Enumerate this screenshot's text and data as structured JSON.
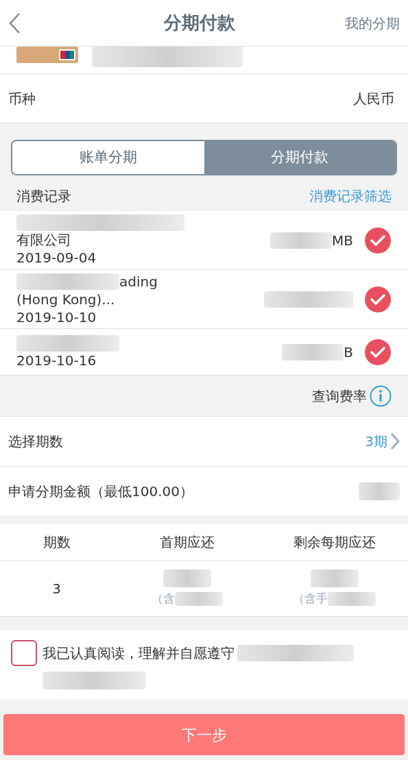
{
  "header": {
    "title": "分期付款",
    "action": "我的分期"
  },
  "currency": {
    "label": "币种",
    "value": "人民币"
  },
  "tabs": [
    {
      "label": "账单分期",
      "selected": false
    },
    {
      "label": "分期付款",
      "selected": true
    }
  ],
  "records_header": {
    "title": "消费记录",
    "filter": "消费记录筛选"
  },
  "records": [
    {
      "name_line2": "有限公司",
      "date": "2019-09-04",
      "amount_end": "MB",
      "checked": true
    },
    {
      "name_end": "ading",
      "name_line2": "(Hong Kong)...",
      "date": "2019-10-10",
      "checked": true
    },
    {
      "date": "2019-10-16",
      "amount_end": "B",
      "checked": true
    }
  ],
  "rate_link": "查询费率",
  "period": {
    "label": "选择期数",
    "value": "3期"
  },
  "amount": {
    "label": "申请分期金额（最低100.00）"
  },
  "table": {
    "columns": [
      "期数",
      "首期应还",
      "剩余每期应还"
    ],
    "rows": [
      [
        "3",
        "（含",
        "（含手"
      ]
    ]
  },
  "agreement": {
    "text": "我已认真阅读，理解并自愿遵守",
    "checked": false
  },
  "next_button": "下一步"
}
